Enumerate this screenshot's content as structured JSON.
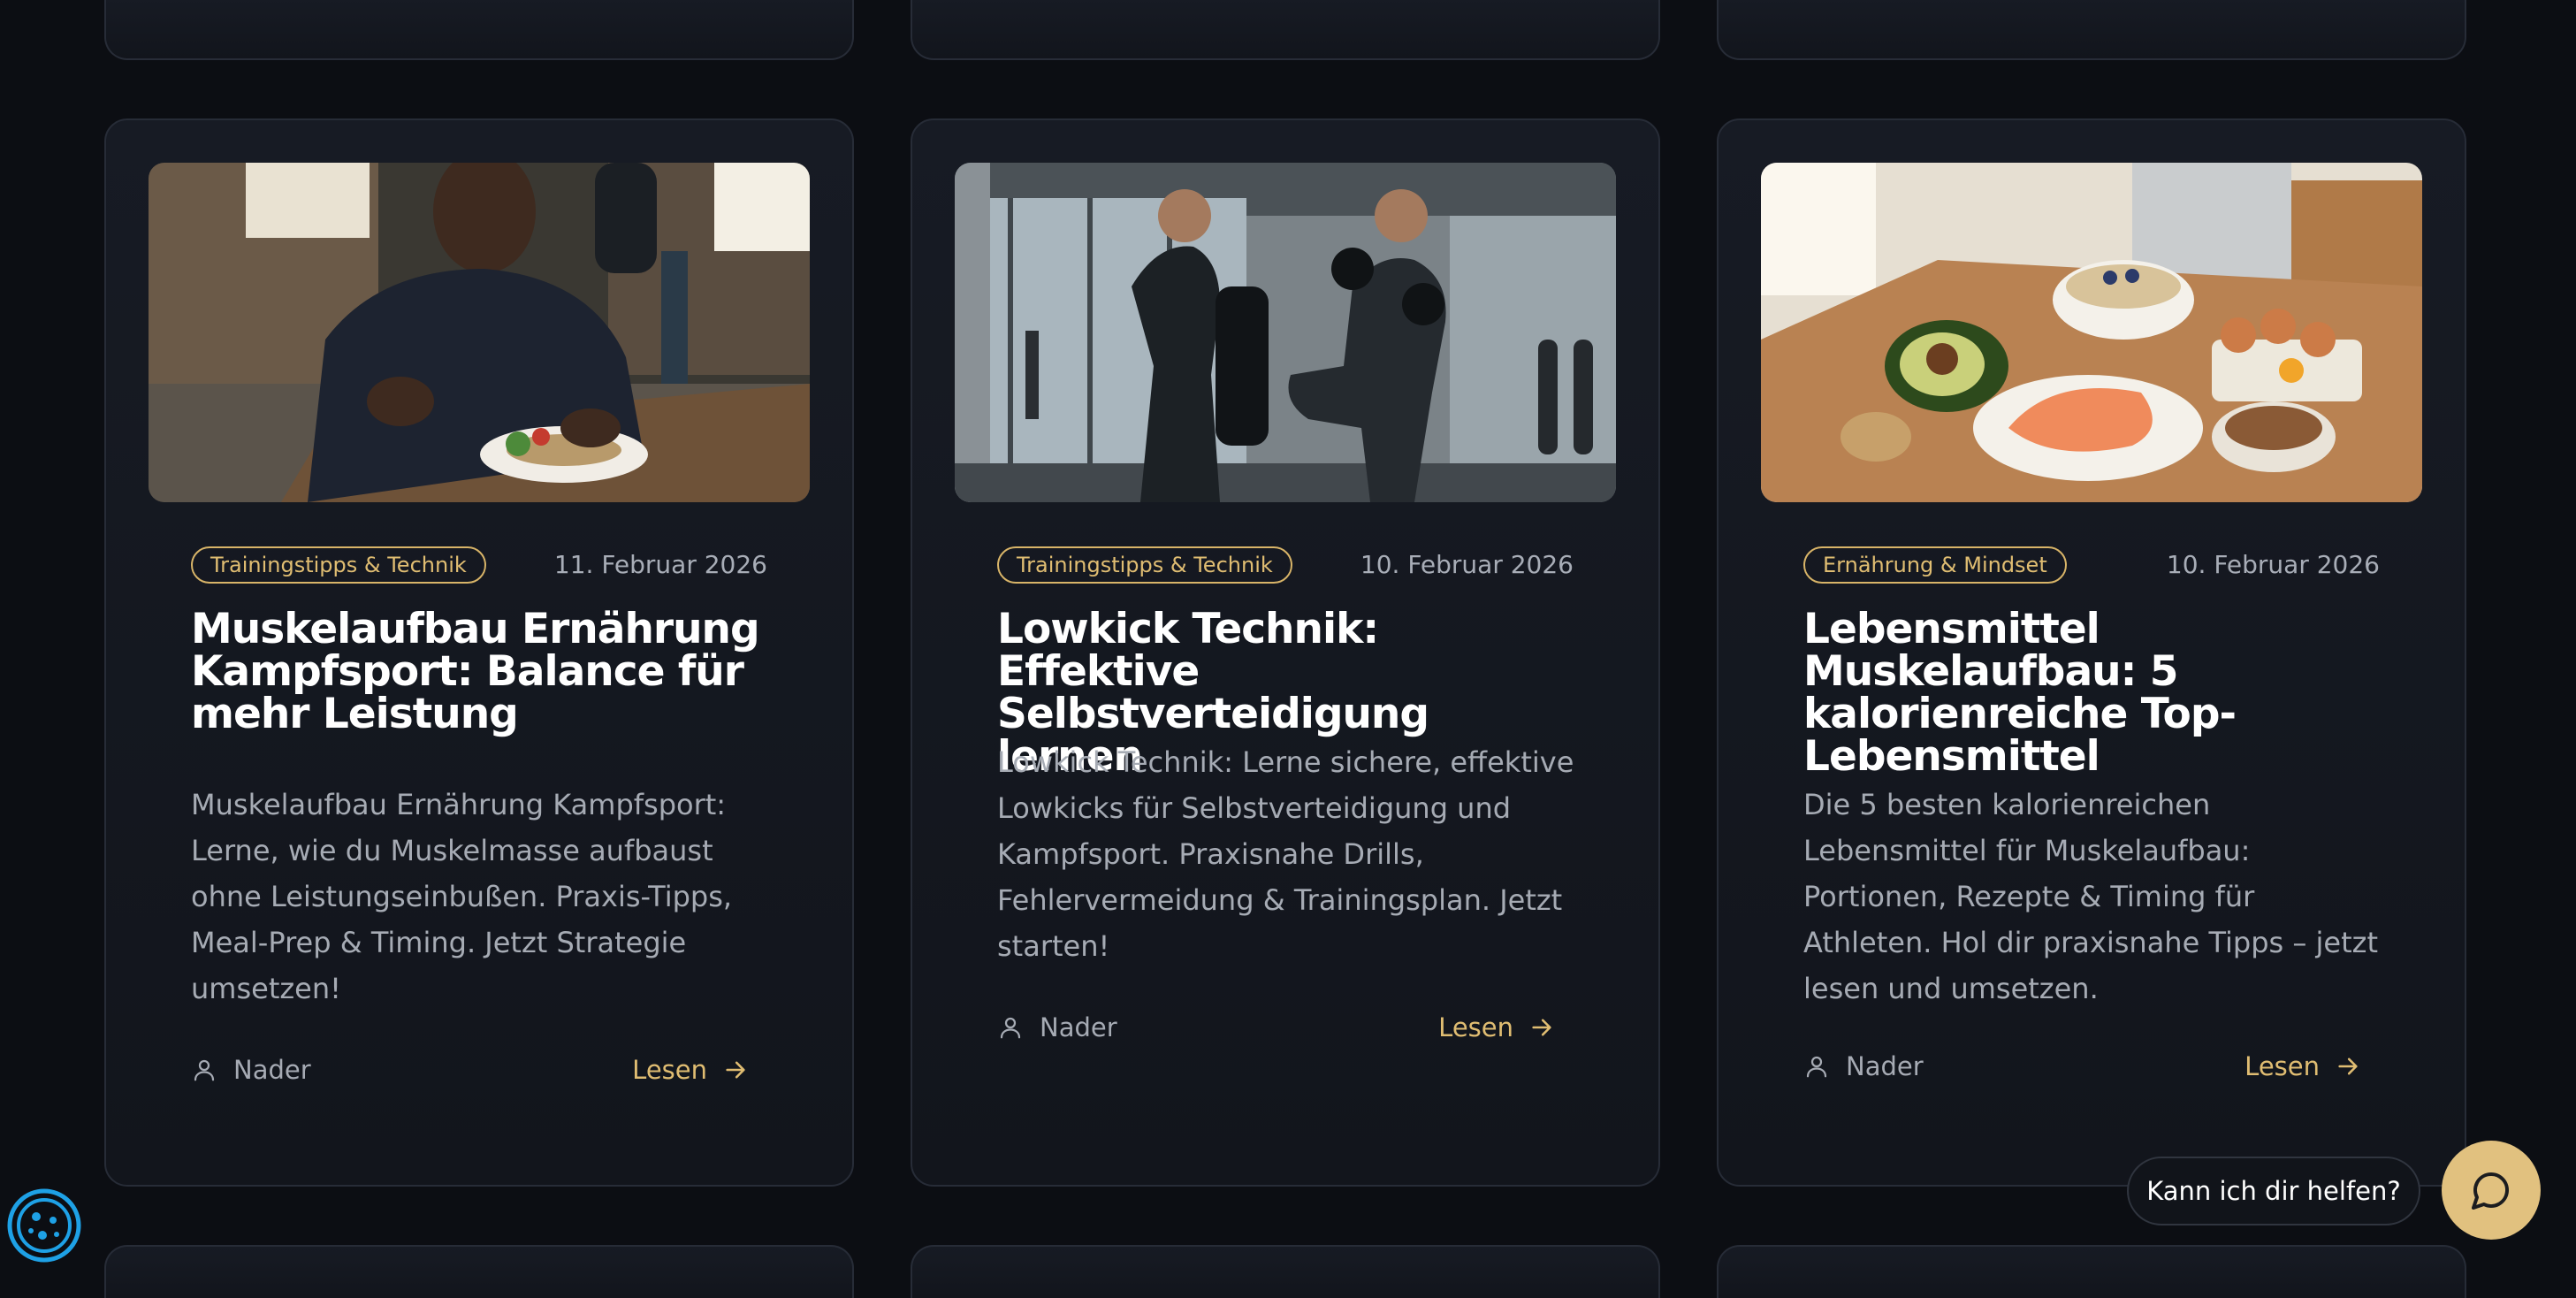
{
  "posts": [
    {
      "category": "Trainingstipps & Technik",
      "date": "11. Februar 2026",
      "title": "Muskelaufbau Ernährung Kampfsport: Balance für mehr Leistung",
      "excerpt": "Muskelaufbau Ernährung Kampfsport: Lerne, wie du Muskelmasse aufbaust ohne Leistungseinbußen. Praxis-Tipps, Meal-Prep & Timing. Jetzt Strategie umsetzen!",
      "author": "Nader",
      "read_label": "Lesen"
    },
    {
      "category": "Trainingstipps & Technik",
      "date": "10. Februar 2026",
      "title": "Lowkick Technik: Effektive Selbstverteidigung lernen",
      "excerpt": "Lowkick Technik: Lerne sichere, effektive Lowkicks für Selbstverteidigung und Kampfsport. Praxisnahe Drills, Fehlervermeidung & Trainingsplan. Jetzt starten!",
      "author": "Nader",
      "read_label": "Lesen"
    },
    {
      "category": "Ernährung & Mindset",
      "date": "10. Februar 2026",
      "title": "Lebensmittel Muskelaufbau: 5 kalorienreiche Top-Lebensmittel",
      "excerpt": "Die 5 besten kalorienreichen Lebensmittel für Muskelaufbau: Portionen, Rezepte & Timing für Athleten. Hol dir praxisnahe Tipps – jetzt lesen und umsetzen.",
      "author": "Nader",
      "read_label": "Lesen"
    }
  ],
  "chat": {
    "prompt": "Kann ich dir helfen?"
  },
  "icons": {
    "author": "user-icon",
    "read": "arrow-right-icon",
    "chat": "chat-bubble-icon",
    "cookie": "cookie-icon"
  },
  "colors": {
    "background": "#0c0e13",
    "card": "#151922",
    "accent": "#e0bd72",
    "cookie": "#1ea1e6"
  }
}
